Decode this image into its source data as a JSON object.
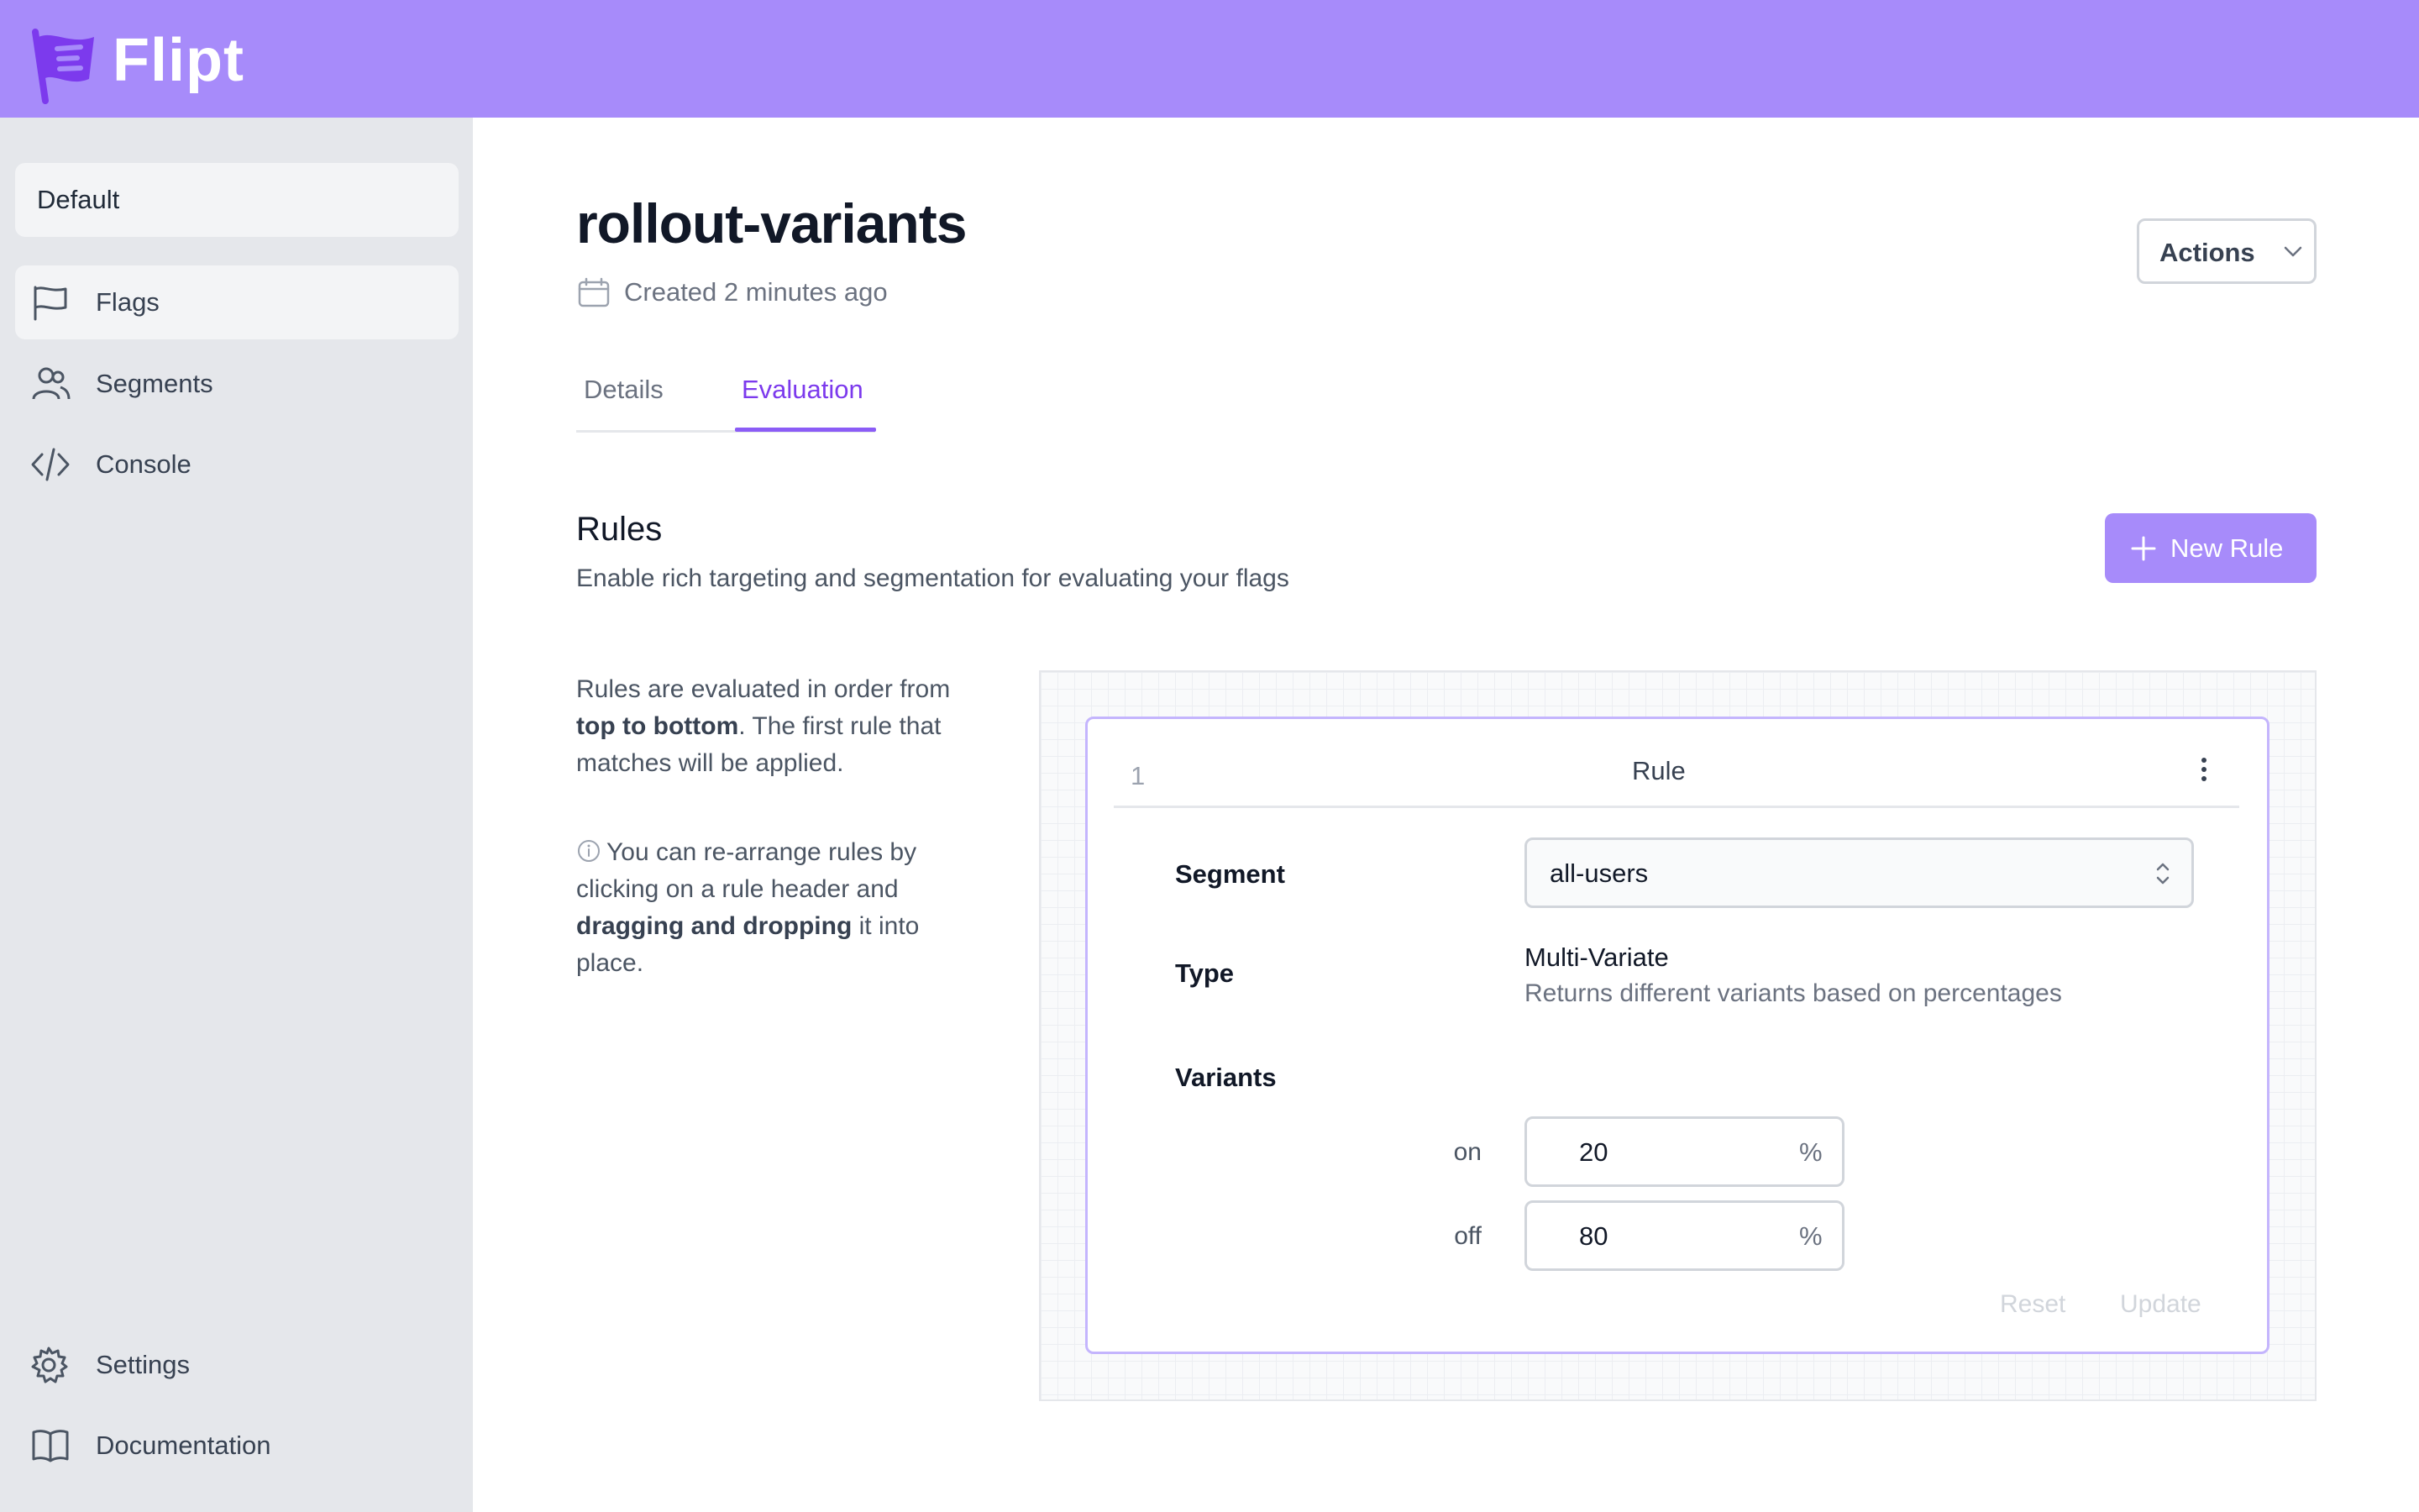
{
  "app": {
    "brand": "Flipt",
    "brand_color": "#a78bfa",
    "accent_color": "#7c3aed"
  },
  "sidebar": {
    "namespace": "Default",
    "items": [
      {
        "label": "Flags",
        "icon": "flag-icon",
        "active": true
      },
      {
        "label": "Segments",
        "icon": "users-icon",
        "active": false
      },
      {
        "label": "Console",
        "icon": "code-icon",
        "active": false
      }
    ],
    "bottom_items": [
      {
        "label": "Settings",
        "icon": "gear-icon"
      },
      {
        "label": "Documentation",
        "icon": "book-icon"
      }
    ]
  },
  "flag": {
    "title": "rollout-variants",
    "created": "Created 2 minutes ago",
    "actions_label": "Actions"
  },
  "tabs": [
    {
      "label": "Details",
      "active": false
    },
    {
      "label": "Evaluation",
      "active": true
    }
  ],
  "rules_section": {
    "title": "Rules",
    "description": "Enable rich targeting and segmentation for evaluating your flags",
    "new_rule_label": "New Rule",
    "help1": {
      "a": "Rules are evaluated in order from ",
      "b": "top to bottom",
      "c": ". The first rule that matches will be applied."
    },
    "help2": {
      "a": "You can re-arrange rules by clicking on a rule header and ",
      "b": "dragging and dropping",
      "c": " it into place."
    }
  },
  "rule": {
    "number": "1",
    "title": "Rule",
    "segment_label": "Segment",
    "segment_value": "all-users",
    "type_label": "Type",
    "type_value": "Multi-Variate",
    "type_desc": "Returns different variants based on percentages",
    "variants_label": "Variants",
    "variants": [
      {
        "key": "on",
        "value": "20",
        "unit": "%"
      },
      {
        "key": "off",
        "value": "80",
        "unit": "%"
      }
    ],
    "reset_label": "Reset",
    "update_label": "Update"
  }
}
